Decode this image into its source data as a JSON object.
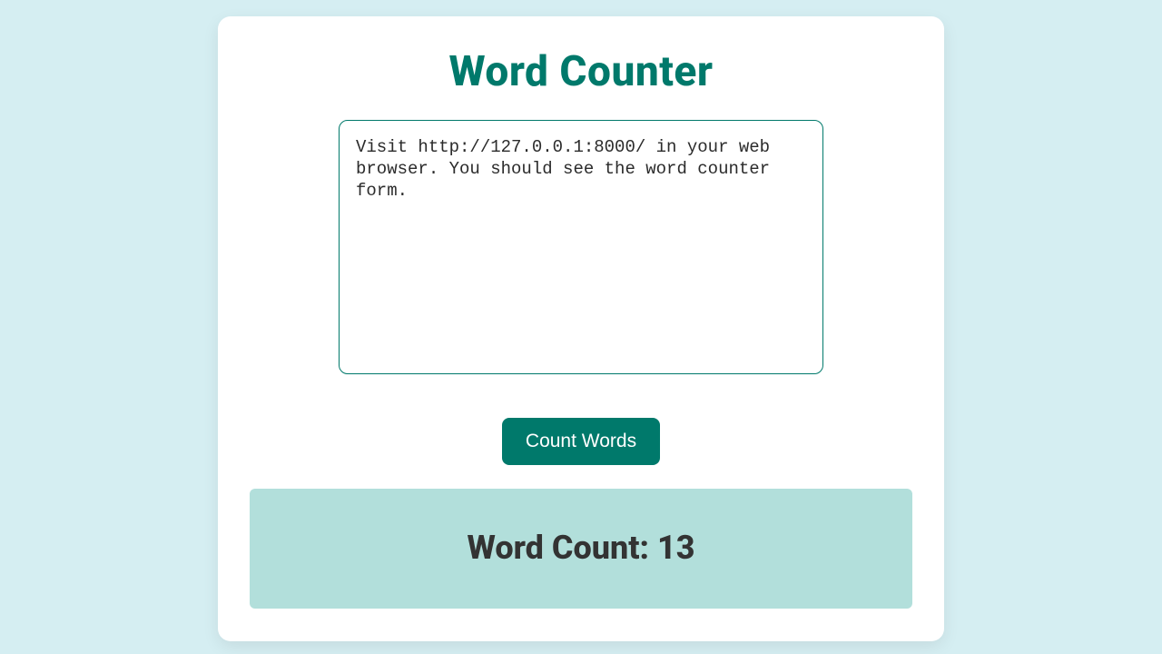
{
  "title": "Word Counter",
  "textarea": {
    "value": "Visit http://127.0.0.1:8000/ in your web browser. You should see the word counter form.",
    "placeholder": ""
  },
  "button": {
    "label": "Count Words"
  },
  "result": {
    "label": "Word Count: ",
    "value": "13"
  },
  "colors": {
    "accent": "#00796b",
    "panel": "#b2dfdb",
    "bg": "#d5eef2"
  }
}
